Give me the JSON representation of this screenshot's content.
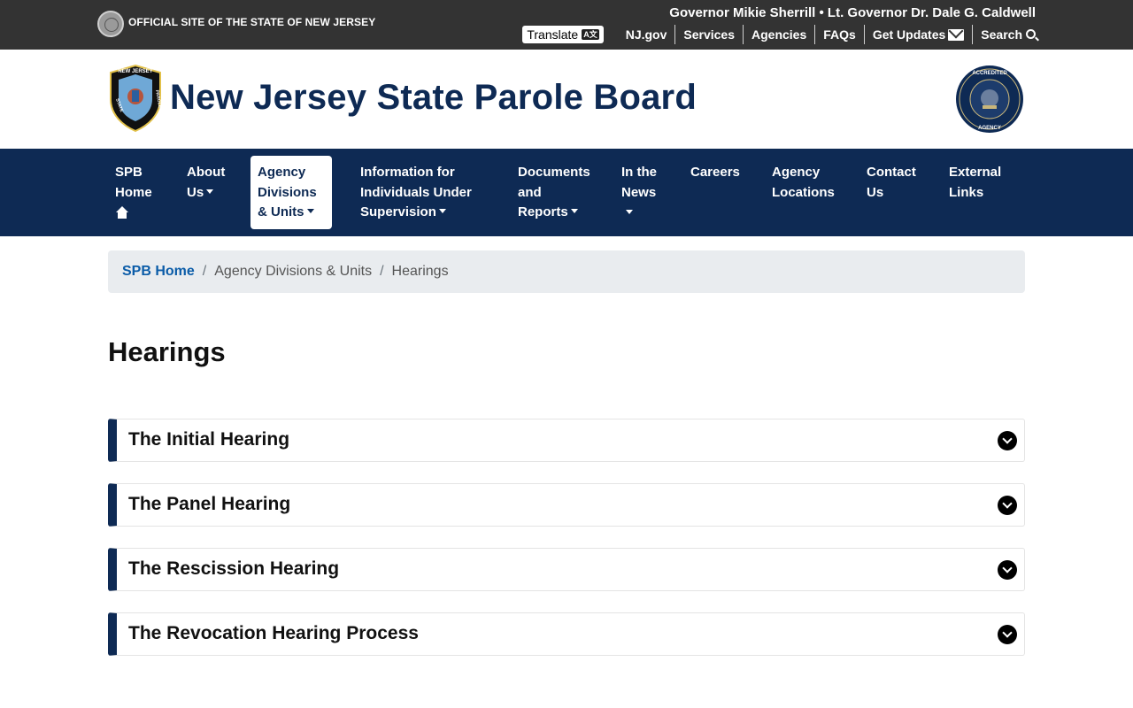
{
  "statebar": {
    "official_text": "OFFICIAL SITE OF THE STATE OF NEW JERSEY",
    "governor_text": "Governor Mikie Sherrill • Lt. Governor Dr. Dale G. Caldwell",
    "translate_label": "Translate",
    "links": [
      "NJ.gov",
      "Services",
      "Agencies",
      "FAQs",
      "Get Updates",
      "Search"
    ]
  },
  "header": {
    "title": "New Jersey State Parole Board",
    "badge_top_text": "NEW JERSEY",
    "badge_left_text": "STATE",
    "badge_right_text": "PAROLE",
    "accreditation_top_text": "ACCREDITED",
    "accreditation_bottom_text": "AGENCY"
  },
  "nav": {
    "items": [
      {
        "label": "SPB Home"
      },
      {
        "label": "About Us"
      },
      {
        "label": "Agency Divisions & Units"
      },
      {
        "label": "Information for Individuals Under Supervision"
      },
      {
        "label": "Documents and Reports"
      },
      {
        "label": "In the News"
      },
      {
        "label": "Careers"
      },
      {
        "label": "Agency Locations"
      },
      {
        "label": "Contact Us"
      },
      {
        "label": "External Links"
      }
    ]
  },
  "breadcrumb": {
    "home": "SPB Home",
    "section": "Agency Divisions & Units",
    "current": "Hearings",
    "separator": "/"
  },
  "page": {
    "title": "Hearings"
  },
  "accordion": {
    "items": [
      {
        "title": "The Initial Hearing"
      },
      {
        "title": "The Panel Hearing"
      },
      {
        "title": "The Rescission Hearing"
      },
      {
        "title": "The Revocation Hearing Process"
      }
    ]
  },
  "colors": {
    "navy": "#0e2a54",
    "statebar": "#333333",
    "link_blue": "#0b5ca8",
    "breadcrumb_bg": "#e9ecef"
  }
}
